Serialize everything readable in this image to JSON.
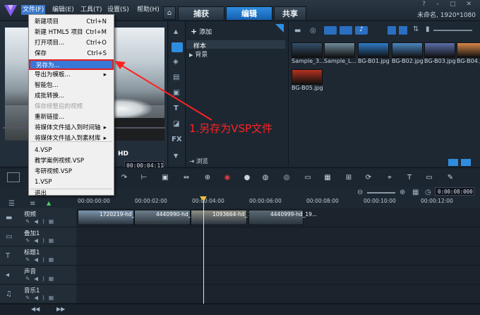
{
  "menubar": {
    "items": [
      "文件(F)",
      "编辑(E)",
      "工具(T)",
      "设置(S)",
      "帮助(H)"
    ],
    "tabs": [
      "捕获",
      "编辑",
      "共享"
    ],
    "project_info": "未命名, 1920*1080"
  },
  "file_menu": {
    "items": [
      {
        "label": "新建项目",
        "shortcut": "Ctrl+N"
      },
      {
        "label": "新建 HTML5 项目",
        "shortcut": "Ctrl+M"
      },
      {
        "label": "打开项目...",
        "shortcut": "Ctrl+O"
      },
      {
        "label": "保存",
        "shortcut": "Ctrl+S"
      },
      {
        "label": "另存为...",
        "shortcut": ""
      },
      {
        "label": "导出为模板...",
        "shortcut": "▸"
      },
      {
        "label": "智能包...",
        "shortcut": ""
      },
      {
        "label": "成批转换...",
        "shortcut": ""
      },
      {
        "label": "保存修整后的视频",
        "shortcut": ""
      },
      {
        "label": "重新链接...",
        "shortcut": ""
      },
      {
        "label": "将媒体文件插入到时间轴",
        "shortcut": "▸"
      },
      {
        "label": "将媒体文件插入到素材库",
        "shortcut": "▸"
      },
      {
        "label": "4.VSP",
        "shortcut": ""
      },
      {
        "label": "教学案例视频.VSP",
        "shortcut": ""
      },
      {
        "label": "考研视频.VSP",
        "shortcut": ""
      },
      {
        "label": "1.VSP",
        "shortcut": ""
      },
      {
        "label": "退出",
        "shortcut": ""
      }
    ]
  },
  "annotation": "1.另存为VSP文件",
  "preview": {
    "timecode": "00:00:04:11",
    "quality": "HD"
  },
  "library": {
    "add_label": "添加",
    "folders": [
      "样本",
      "背景"
    ],
    "browse_label": "浏览"
  },
  "media": {
    "items": [
      {
        "label": "Sample_3...",
        "color": "#35506a"
      },
      {
        "label": "Sample_L...",
        "color": "#6f8a9a"
      },
      {
        "label": "BG-B01.jpg",
        "color": "#2f7bc8"
      },
      {
        "label": "BG-B02.jpg",
        "color": "#4a86c0"
      },
      {
        "label": "BG-B03.jpg",
        "color": "#5a6fa8"
      },
      {
        "label": "BG-B04.jpg",
        "color": "#d8874a"
      },
      {
        "label": "BG-B05.jpg",
        "color": "#b4321e"
      }
    ]
  },
  "timeline": {
    "zoom_time": "0:00:08:000",
    "ruler": [
      "00:00:00:00",
      "00:00:02:00",
      "00:00:04:00",
      "00:00:06:00",
      "00:00:08:00",
      "00:00:10:00",
      "00:00:12:00"
    ],
    "tracks": [
      {
        "name": "视频"
      },
      {
        "name": "叠加1"
      },
      {
        "name": "标题1"
      },
      {
        "name": "声音"
      },
      {
        "name": "音乐1"
      }
    ],
    "clips": [
      "1720219-hd_19...",
      "4440990-hd_19...",
      "1093664-hd_19...",
      "4440999-hd_19..."
    ]
  },
  "colors": {
    "accent": "#2f8de0",
    "highlight_border": "#e02020",
    "annotation": "#ff2222"
  }
}
